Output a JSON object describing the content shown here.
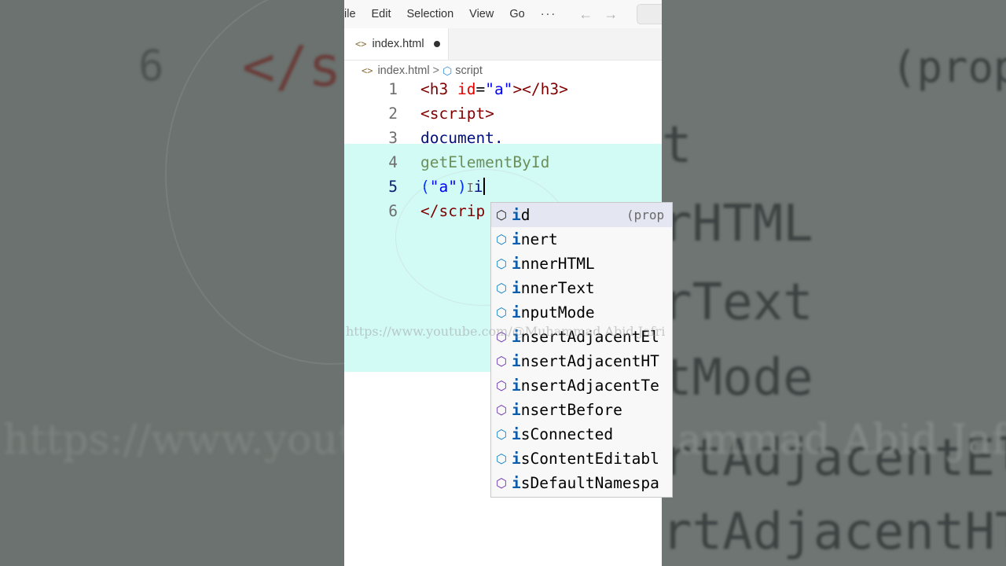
{
  "menubar": {
    "items": [
      "ile",
      "Edit",
      "Selection",
      "View",
      "Go"
    ],
    "more": "···",
    "back_icon": "arrow-left-icon",
    "forward_icon": "arrow-right-icon"
  },
  "tab": {
    "icon": "<>",
    "label": "index.html",
    "modified": true
  },
  "breadcrumb": {
    "file_icon": "<>",
    "file": "index.html",
    "separator": ">",
    "symbol_icon": "cube-icon",
    "symbol": "script"
  },
  "code": {
    "lines": [
      {
        "num": "1"
      },
      {
        "num": "2"
      },
      {
        "num": "3"
      },
      {
        "num": "4"
      },
      {
        "num": "5"
      },
      {
        "num": "6"
      }
    ],
    "l1": {
      "open": "<h3 ",
      "attr": "id",
      "eq": "=",
      "val": "\"a\"",
      "close": "></h3>"
    },
    "l2": {
      "text": "<script>"
    },
    "l3": {
      "text": "document."
    },
    "l4": {
      "text": "getElementById"
    },
    "l5": {
      "p1": "(",
      "s": "\"a\"",
      "p2": ")",
      "typed": "i"
    },
    "l6": {
      "text": "</scrip"
    }
  },
  "suggestions": [
    {
      "match": "i",
      "rest": "d",
      "kind": "property-selected"
    },
    {
      "match": "i",
      "rest": "nert",
      "kind": "field"
    },
    {
      "match": "i",
      "rest": "nnerHTML",
      "kind": "field"
    },
    {
      "match": "i",
      "rest": "nnerText",
      "kind": "field"
    },
    {
      "match": "i",
      "rest": "nputMode",
      "kind": "field"
    },
    {
      "match": "i",
      "rest": "nsertAdjacentEl",
      "kind": "method"
    },
    {
      "match": "i",
      "rest": "nsertAdjacentHT",
      "kind": "method"
    },
    {
      "match": "i",
      "rest": "nsertAdjacentTe",
      "kind": "method"
    },
    {
      "match": "i",
      "rest": "nsertBefore",
      "kind": "method"
    },
    {
      "match": "i",
      "rest": "sConnected",
      "kind": "field"
    },
    {
      "match": "i",
      "rest": "sContentEditabl",
      "kind": "field"
    },
    {
      "match": "i",
      "rest": "sDefaultNamespa",
      "kind": "method"
    }
  ],
  "suggestion_detail": "(prop",
  "watermark": "https://www.youtube.com/@Muhammad Abid Jafri",
  "background": {
    "left_num": "6",
    "left_code": "</sc",
    "right_items": [
      "(prop",
      "t",
      "rHTML",
      "rText",
      "tMode",
      "rtAdjacentEl",
      "rtAdjacentHT"
    ],
    "watermark": "https://www.yout",
    "watermark_right": "ammad Abid Jafri"
  },
  "colors": {
    "highlight": "#d2fbf6",
    "tag": "#800000",
    "attr": "#e50000",
    "string": "#0000ff",
    "identifier": "#001080",
    "function": "#6c8f5a"
  }
}
